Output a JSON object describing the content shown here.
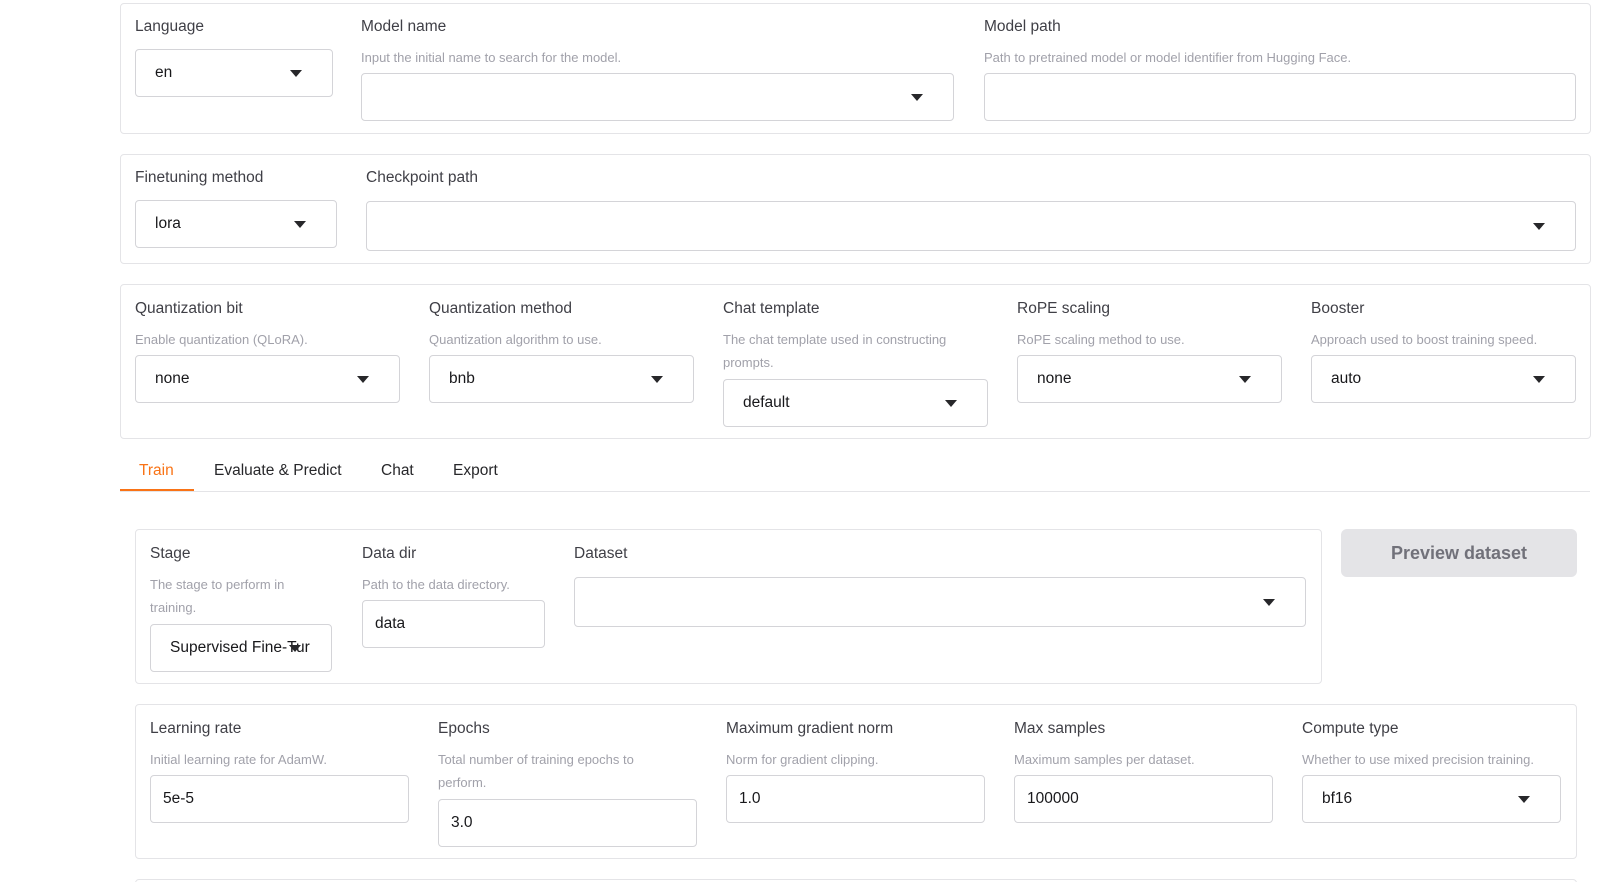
{
  "top": {
    "language": {
      "label": "Language",
      "value": "en"
    },
    "model_name": {
      "label": "Model name",
      "info": "Input the initial name to search for the model.",
      "value": ""
    },
    "model_path": {
      "label": "Model path",
      "info": "Path to pretrained model or model identifier from Hugging Face.",
      "value": ""
    }
  },
  "finetune": {
    "method": {
      "label": "Finetuning method",
      "value": "lora"
    },
    "checkpoint": {
      "label": "Checkpoint path",
      "value": ""
    }
  },
  "advanced": {
    "quant_bit": {
      "label": "Quantization bit",
      "info": "Enable quantization (QLoRA).",
      "value": "none"
    },
    "quant_method": {
      "label": "Quantization method",
      "info": "Quantization algorithm to use.",
      "value": "bnb"
    },
    "chat_template": {
      "label": "Chat template",
      "info": "The chat template used in constructing prompts.",
      "value": "default"
    },
    "rope": {
      "label": "RoPE scaling",
      "info": "RoPE scaling method to use.",
      "value": "none"
    },
    "booster": {
      "label": "Booster",
      "info": "Approach used to boost training speed.",
      "value": "auto"
    }
  },
  "tabs": [
    {
      "label": "Train",
      "active": true
    },
    {
      "label": "Evaluate & Predict",
      "active": false
    },
    {
      "label": "Chat",
      "active": false
    },
    {
      "label": "Export",
      "active": false
    }
  ],
  "train": {
    "stage": {
      "label": "Stage",
      "info": "The stage to perform in training.",
      "value": "Supervised Fine-Tur"
    },
    "data_dir": {
      "label": "Data dir",
      "info": "Path to the data directory.",
      "value": "data"
    },
    "dataset": {
      "label": "Dataset",
      "value": ""
    },
    "preview_button": "Preview dataset",
    "learning_rate": {
      "label": "Learning rate",
      "info": "Initial learning rate for AdamW.",
      "value": "5e-5"
    },
    "epochs": {
      "label": "Epochs",
      "info": "Total number of training epochs to perform.",
      "value": "3.0"
    },
    "max_grad_norm": {
      "label": "Maximum gradient norm",
      "info": "Norm for gradient clipping.",
      "value": "1.0"
    },
    "max_samples": {
      "label": "Max samples",
      "info": "Maximum samples per dataset.",
      "value": "100000"
    },
    "compute_type": {
      "label": "Compute type",
      "info": "Whether to use mixed precision training.",
      "value": "bf16"
    }
  },
  "colors": {
    "accent": "#f97316",
    "border": "#e4e4e7",
    "muted": "#a1a1aa",
    "button_bg": "#e4e4e7"
  }
}
